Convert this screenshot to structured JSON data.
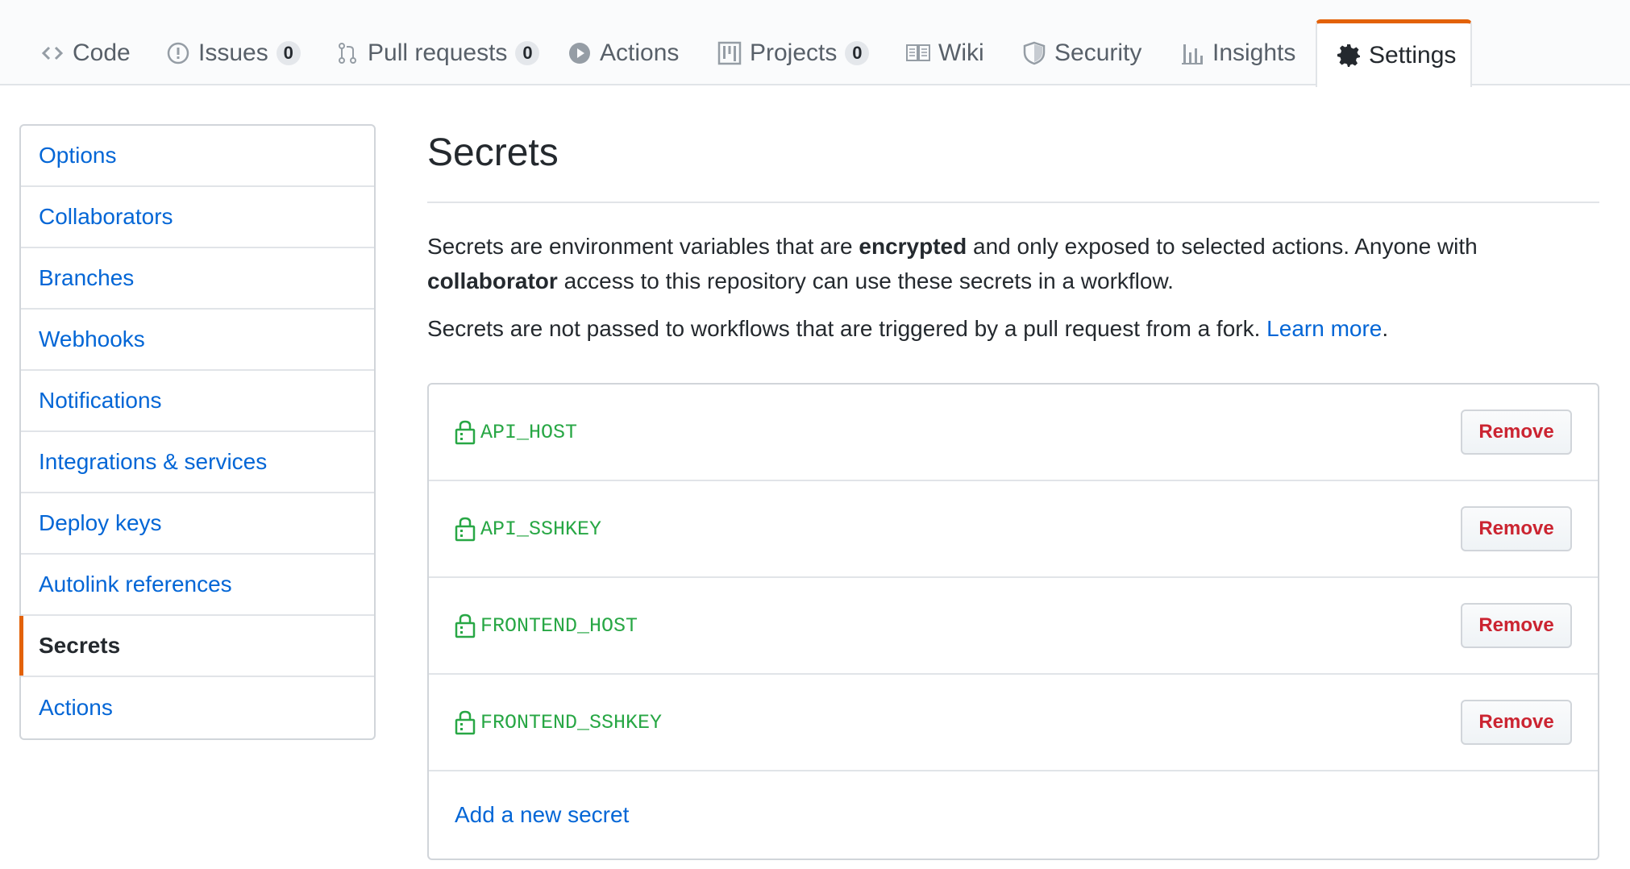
{
  "tabs": [
    {
      "label": "Code",
      "icon": "code-icon"
    },
    {
      "label": "Issues",
      "icon": "issue-icon",
      "count": "0"
    },
    {
      "label": "Pull requests",
      "icon": "pull-request-icon",
      "count": "0"
    },
    {
      "label": "Actions",
      "icon": "play-icon"
    },
    {
      "label": "Projects",
      "icon": "project-icon",
      "count": "0"
    },
    {
      "label": "Wiki",
      "icon": "book-icon"
    },
    {
      "label": "Security",
      "icon": "shield-icon"
    },
    {
      "label": "Insights",
      "icon": "graph-icon"
    },
    {
      "label": "Settings",
      "icon": "gear-icon",
      "selected": true
    }
  ],
  "menu": {
    "items": [
      "Options",
      "Collaborators",
      "Branches",
      "Webhooks",
      "Notifications",
      "Integrations & services",
      "Deploy keys",
      "Autolink references",
      "Secrets",
      "Actions"
    ],
    "selected": "Secrets"
  },
  "main": {
    "title": "Secrets",
    "desc": {
      "p1_a": "Secrets are environment variables that are ",
      "p1_b": "encrypted",
      "p1_c": " and only exposed to selected actions. Anyone with ",
      "p1_d": "collaborator",
      "p1_e": " access to this repository can use these secrets in a workflow.",
      "p2_a": "Secrets are not passed to workflows that are triggered by a pull request from a fork. ",
      "p2_link": "Learn more",
      "p2_end": "."
    },
    "secrets": [
      {
        "name": "API_HOST",
        "action": "Remove"
      },
      {
        "name": "API_SSHKEY",
        "action": "Remove"
      },
      {
        "name": "FRONTEND_HOST",
        "action": "Remove"
      },
      {
        "name": "FRONTEND_SSHKEY",
        "action": "Remove"
      }
    ],
    "add_label": "Add a new secret"
  },
  "colors": {
    "accent_orange": "#e36209",
    "link_blue": "#0366d6",
    "secret_green": "#28a745",
    "danger_red": "#cb2431"
  }
}
